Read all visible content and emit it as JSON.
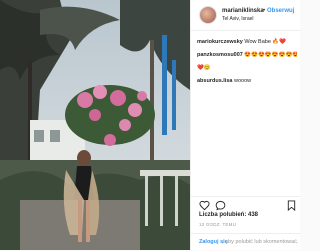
{
  "post": {
    "username": "marianiklinska",
    "separator": "•",
    "follow_label": "Obserwuj",
    "location": "Tel Aviv, Israel"
  },
  "comments": [
    {
      "user": "mariokurczewsky",
      "text": "Wow Babe 🔥❤️"
    },
    {
      "user": "panzkosmosu007",
      "text": "😍😍😍😍😍😍😍😍😍"
    },
    {
      "user": "",
      "text": "❤️😊"
    },
    {
      "user": "absurdus.lisa",
      "text": "wooow"
    }
  ],
  "actions": {
    "like_icon": "heart-icon",
    "comment_icon": "comment-icon",
    "save_icon": "bookmark-icon"
  },
  "likes_text": "Liczba polubień: 438",
  "timestamp": "12 GODZ. TEMU",
  "login": {
    "link": "Zaloguj się",
    "rest": ", aby polubić lub skomentować."
  },
  "colors": {
    "link": "#3897f0",
    "text": "#262626",
    "muted": "#999999",
    "divider": "#efefef"
  }
}
